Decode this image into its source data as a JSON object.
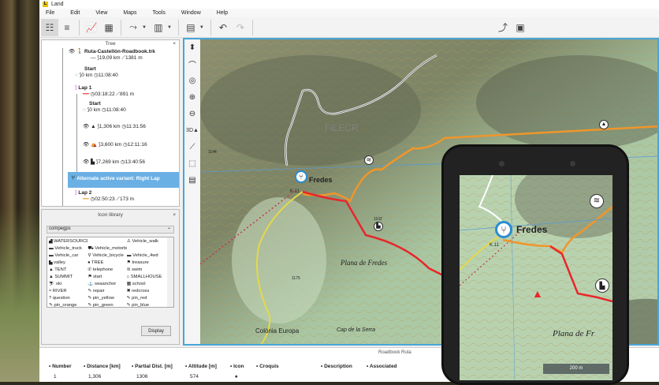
{
  "app": {
    "title": "Land",
    "logo": "L"
  },
  "menu": [
    "File",
    "Edit",
    "View",
    "Maps",
    "Tools",
    "Window",
    "Help"
  ],
  "toolbar": {
    "icons": [
      "tree-view-icon",
      "list-icon",
      "chart-icon",
      "calendar-icon",
      "route-icon",
      "map-icon",
      "layers-icon",
      "undo-icon",
      "redo-icon",
      "gps-route-icon",
      "device-icon"
    ]
  },
  "tree": {
    "title": "Tree",
    "close": "×",
    "track": {
      "name": "Ruta-Castellón-Roadbook.trk",
      "dist": "19,09 km",
      "elev": "1381 m"
    },
    "start1": {
      "label": "Start",
      "dist": "0 km",
      "time": "11:08:40"
    },
    "lap1": {
      "label": "Lap 1",
      "time": "03:18:22",
      "elev": "891 m"
    },
    "start2": {
      "label": "Start",
      "dist": "0 km",
      "time": "11:08:40"
    },
    "wps": [
      {
        "dist": "1,306 km",
        "time": "11:31:56",
        "icon": "▲"
      },
      {
        "dist": "3,600 km",
        "time": "12:11:16",
        "icon": "⛺"
      },
      {
        "dist": "7,269 km",
        "time": "13:40:56",
        "icon": "▙"
      }
    ],
    "variant": "Alternate active variant: Right Lap",
    "lap2": {
      "label": "Lap 2",
      "time": "02:50:23",
      "elev": "173 m"
    }
  },
  "iconlib": {
    "title": "Icon library",
    "close": "×",
    "category": "compegps",
    "display": "Display",
    "items": [
      "WATERSOURCE",
      "",
      "Vehicle_walk",
      "Vehicle_truck",
      "Vehicle_motorbike",
      "",
      "Vehicle_car",
      "Vehicle_bicycle",
      "Vehicle_4wd",
      "valley",
      "TREE",
      "treasure",
      "TENT",
      "telephone",
      "swim",
      "SUMMIT",
      "start",
      "SMALLHOUSE",
      "ski",
      "seaanchor",
      "school",
      "RIVER",
      "repair",
      "redcross",
      "question",
      "pin_yellow",
      "pin_red",
      "pin_orange",
      "pin_green",
      "pin_blue"
    ]
  },
  "map": {
    "labels": {
      "town": "Fredes",
      "road": "K.11",
      "plain": "Plana de Fredes",
      "colonia": "Colònia Europa",
      "cap": "Cap de la Serra",
      "watermark": "FILECR",
      "alt1": "1144",
      "alt2": "1175",
      "alt3": "1102"
    },
    "route_color": "#e8262b",
    "alt_route_color": "#f0962a"
  },
  "phone": {
    "town": "Fredes",
    "road": "K.11",
    "plain": "Plana de Fr",
    "scale": "200 m"
  },
  "roadbook": {
    "title": "Roadbook Ruta",
    "headers": [
      "Number",
      "Distance [km]",
      "Partial Dist. [m]",
      "Altitude [m]",
      "Icon",
      "Croquis",
      "Description",
      "Associated"
    ],
    "row": {
      "number": "1",
      "distance": "1,306",
      "partial": "1306",
      "altitude": "574",
      "icon": "♠"
    }
  }
}
